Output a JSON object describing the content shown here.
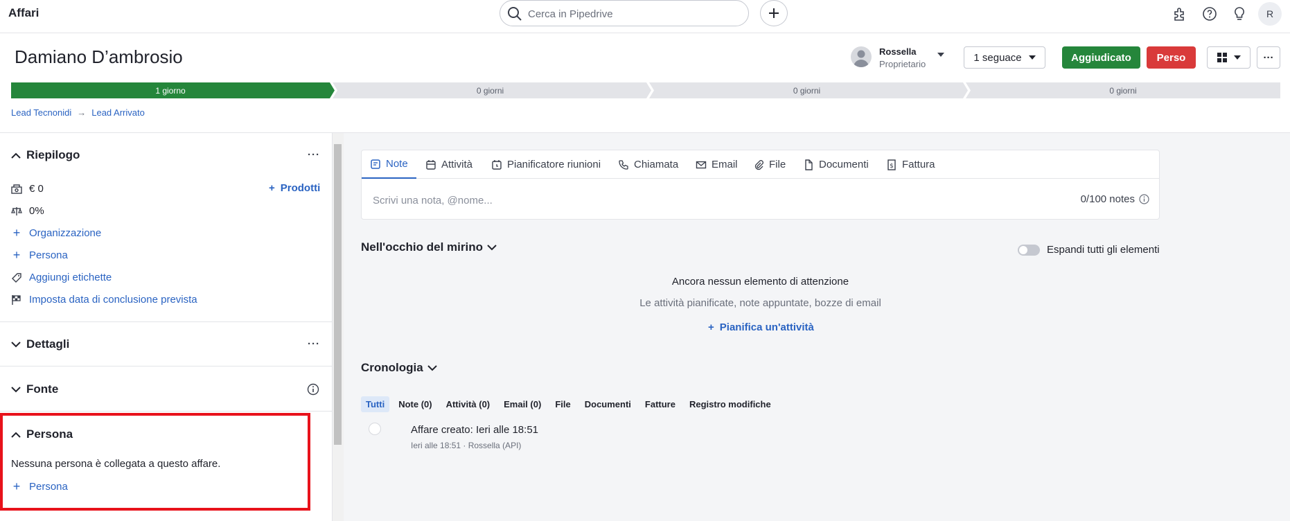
{
  "topbar": {
    "title": "Affari",
    "search_placeholder": "Cerca in Pipedrive",
    "avatar_initial": "R"
  },
  "header": {
    "deal_title": "Damiano D’ambrosio",
    "owner_name": "Rossella",
    "owner_role": "Proprietario",
    "followers_label": "1 seguace",
    "won_label": "Aggiudicato",
    "lost_label": "Perso"
  },
  "pipeline": {
    "stages": [
      {
        "label": "1 giorno",
        "active": true
      },
      {
        "label": "0 giorni",
        "active": false
      },
      {
        "label": "0 giorni",
        "active": false
      },
      {
        "label": "0 giorni",
        "active": false
      }
    ],
    "colors": {
      "active": "#25863b",
      "inactive": "#e3e4e8"
    }
  },
  "breadcrumb": {
    "pipeline": "Lead Tecnonidi",
    "stage": "Lead Arrivato"
  },
  "sidebar": {
    "summary": {
      "title": "Riepilogo",
      "value": "€ 0",
      "probability": "0%",
      "add_products": "Prodotti",
      "organization": "Organizzazione",
      "person": "Persona",
      "add_labels": "Aggiungi etichette",
      "set_close_date": "Imposta data di conclusione prevista"
    },
    "details_title": "Dettagli",
    "source_title": "Fonte",
    "person_section": {
      "title": "Persona",
      "empty_text": "Nessuna persona è collegata a questo affare.",
      "add_label": "Persona"
    }
  },
  "composer": {
    "tabs": [
      "Note",
      "Attività",
      "Pianificatore riunioni",
      "Chiamata",
      "Email",
      "File",
      "Documenti",
      "Fattura"
    ],
    "active_tab": "Note",
    "placeholder": "Scrivi una nota, @nome...",
    "notes_count": "0/100 notes"
  },
  "focus": {
    "title": "Nell'occhio del mirino",
    "expand_label": "Espandi tutti gli elementi",
    "empty_title": "Ancora nessun elemento di attenzione",
    "empty_sub": "Le attività pianificate, note appuntate, bozze di email",
    "plan_activity": "Pianifica un'attività"
  },
  "history": {
    "title": "Cronologia",
    "filters": [
      "Tutti",
      "Note (0)",
      "Attività (0)",
      "Email (0)",
      "File",
      "Documenti",
      "Fatture",
      "Registro modifiche"
    ],
    "active_filter": "Tutti",
    "event_title": "Affare creato: Ieri alle 18:51",
    "event_meta": "Ieri alle 18:51 · Rossella (API)"
  },
  "highlight_color": "#e8121b"
}
